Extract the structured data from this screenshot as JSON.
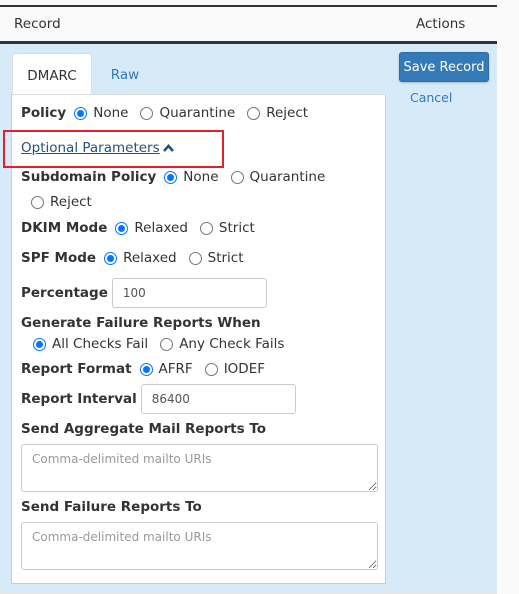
{
  "header": {
    "record_label": "Record",
    "actions_label": "Actions"
  },
  "tabs": [
    {
      "label": "DMARC",
      "active": true
    },
    {
      "label": "Raw",
      "active": false
    }
  ],
  "actions": {
    "save_label": "Save Record",
    "cancel_label": "Cancel"
  },
  "colors": {
    "panel_bg": "#d6eaf8",
    "primary": "#337ab7",
    "highlight": "#e0202a"
  },
  "form": {
    "policy": {
      "label": "Policy",
      "options": [
        "None",
        "Quarantine",
        "Reject"
      ],
      "selected": "None"
    },
    "optional_link": {
      "label": "Optional Parameters",
      "icon": "chevron-up-icon"
    },
    "subdomain_policy": {
      "label": "Subdomain Policy",
      "options": [
        "None",
        "Quarantine",
        "Reject"
      ],
      "selected": "None"
    },
    "dkim_mode": {
      "label": "DKIM Mode",
      "options": [
        "Relaxed",
        "Strict"
      ],
      "selected": "Relaxed"
    },
    "spf_mode": {
      "label": "SPF Mode",
      "options": [
        "Relaxed",
        "Strict"
      ],
      "selected": "Relaxed"
    },
    "percentage": {
      "label": "Percentage",
      "value": "100"
    },
    "failure_reports_when": {
      "label": "Generate Failure Reports When",
      "options": [
        "All Checks Fail",
        "Any Check Fails"
      ],
      "selected": "All Checks Fail"
    },
    "report_format": {
      "label": "Report Format",
      "options": [
        "AFRF",
        "IODEF"
      ],
      "selected": "AFRF"
    },
    "report_interval": {
      "label": "Report Interval",
      "value": "86400"
    },
    "aggregate_to": {
      "label": "Send Aggregate Mail Reports To",
      "placeholder": "Comma-delimited mailto URIs",
      "value": ""
    },
    "failure_to": {
      "label": "Send Failure Reports To",
      "placeholder": "Comma-delimited mailto URIs",
      "value": ""
    }
  }
}
